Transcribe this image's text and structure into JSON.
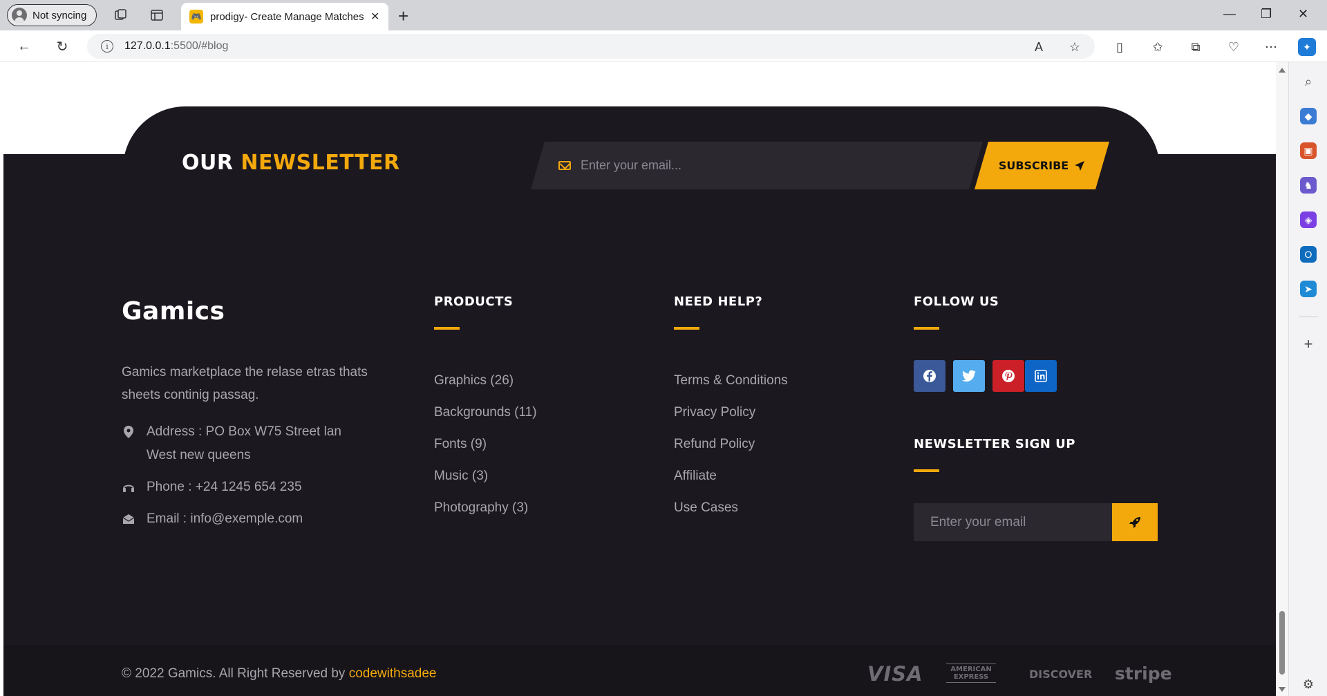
{
  "browser": {
    "profile_label": "Not syncing",
    "tab_title": "prodigy- Create Manage Matches",
    "url_host": "127.0.0.1",
    "url_path": ":5500/#blog"
  },
  "newsletter": {
    "title_white": "OUR",
    "title_accent": "NEWSLETTER",
    "email_placeholder": "Enter your email...",
    "subscribe_label": "SUBSCRIBE"
  },
  "about": {
    "brand": "Gamics",
    "description": "Gamics marketplace the relase etras thats sheets continig passag.",
    "address_line1": "Address : PO Box W75 Street lan",
    "address_line2": "West new queens",
    "phone": "Phone : +24 1245 654 235",
    "email": "Email : info@exemple.com"
  },
  "products": {
    "title": "PRODUCTS",
    "items": [
      "Graphics (26)",
      "Backgrounds (11)",
      "Fonts (9)",
      "Music (3)",
      "Photography (3)"
    ]
  },
  "help": {
    "title": "NEED HELP?",
    "items": [
      "Terms & Conditions",
      "Privacy Policy",
      "Refund Policy",
      "Affiliate",
      "Use Cases"
    ]
  },
  "follow": {
    "title": "FOLLOW US",
    "socials": [
      {
        "icon": "facebook-icon",
        "color": "#3b5998"
      },
      {
        "icon": "twitter-icon",
        "color": "#55acee"
      },
      {
        "icon": "pinterest-icon",
        "color": "#cb2027"
      },
      {
        "icon": "linkedin-icon",
        "color": "#0e65c6"
      }
    ]
  },
  "signup": {
    "title": "NEWSLETTER SIGN UP",
    "email_placeholder": "Enter your email"
  },
  "bottom": {
    "copyright_text": "© 2022 Gamics. All Right Reserved by",
    "copyright_link": "codewithsadee",
    "payments": [
      "VISA",
      "AMERICAN EXPRESS",
      "DISCOVER",
      "stripe"
    ]
  },
  "colors": {
    "accent": "#f3a90c",
    "footer_bg": "#1c1820",
    "bottom_bg": "#17141a"
  }
}
